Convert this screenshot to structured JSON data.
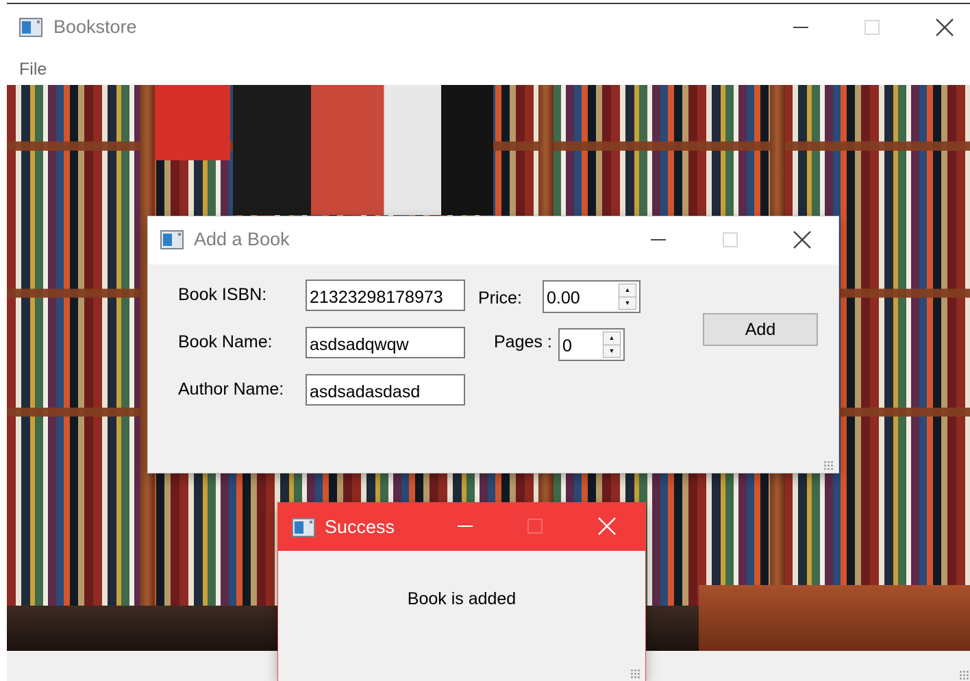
{
  "main_window": {
    "title": "Bookstore",
    "menu": [
      "File"
    ]
  },
  "add_dialog": {
    "title": "Add a Book",
    "isbn_label": "Book ISBN:",
    "isbn_value": "21323298178973",
    "name_label": "Book Name:",
    "name_value": "asdsadqwqw",
    "author_label": "Author Name:",
    "author_value": "asdsadasdasd",
    "price_label": "Price:",
    "price_value": "0.00",
    "pages_label": "Pages :",
    "pages_value": "0",
    "add_button": "Add"
  },
  "success_dialog": {
    "title": "Success",
    "message": "Book is added"
  },
  "colors": {
    "success_title_bar": "#f23b3b",
    "dialog_background": "#f0f0f0",
    "window_title_text": "#7d7d7d"
  },
  "icons": {
    "app": "window-app-icon",
    "minimize": "minimize-icon",
    "maximize": "maximize-icon",
    "close": "close-icon",
    "spin_up": "arrow-up-icon",
    "spin_down": "arrow-down-icon",
    "resize": "resize-grip-icon"
  }
}
